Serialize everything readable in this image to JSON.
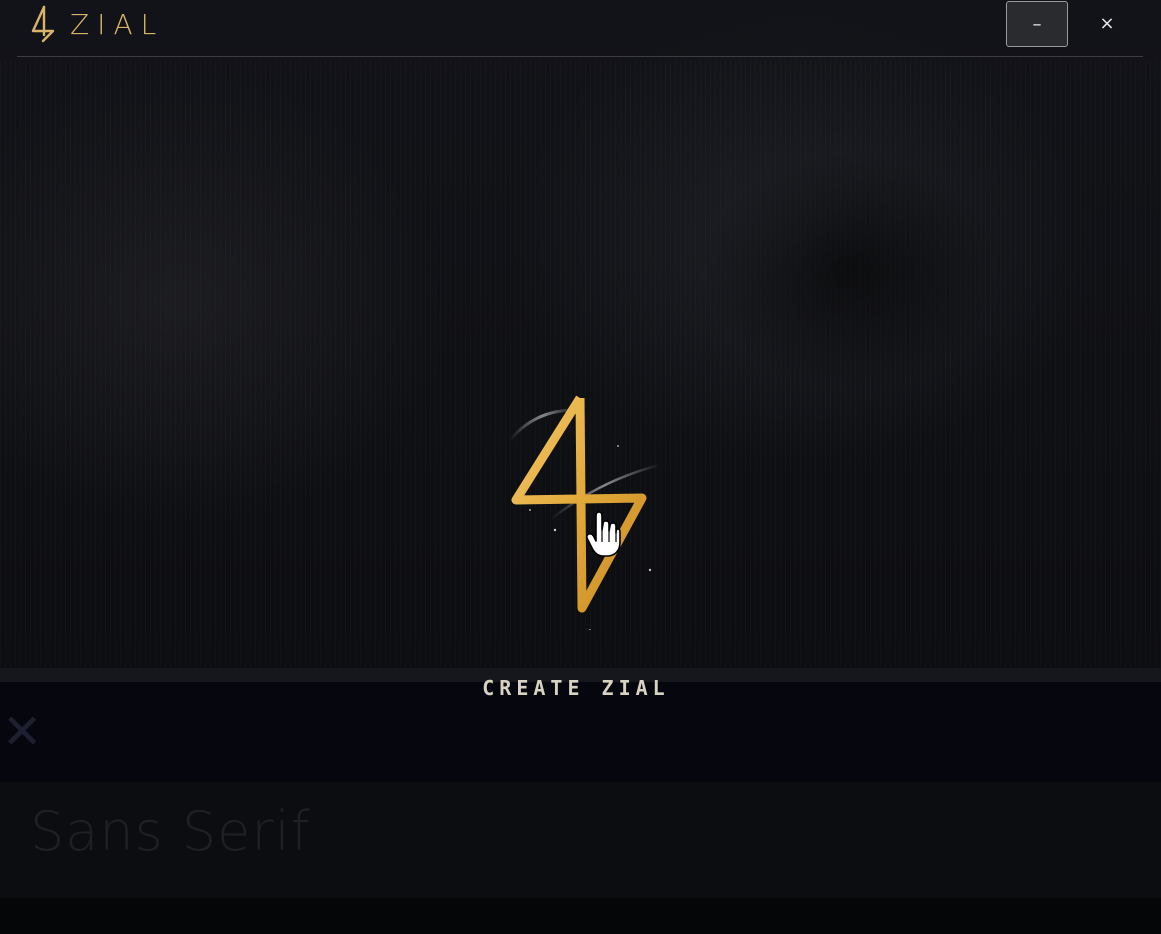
{
  "window": {
    "title": "ZIAL",
    "minimize_label": "–",
    "close_label": "×"
  },
  "splash": {
    "logo_icon": "zial-bolt-logo",
    "action_label": "CREATE ZIAL"
  },
  "background": {
    "close_glyph": "✕",
    "font_sample": "Sans Serif"
  },
  "colors": {
    "accent_gold": "#d8b36a",
    "background": "#0b0c10"
  }
}
